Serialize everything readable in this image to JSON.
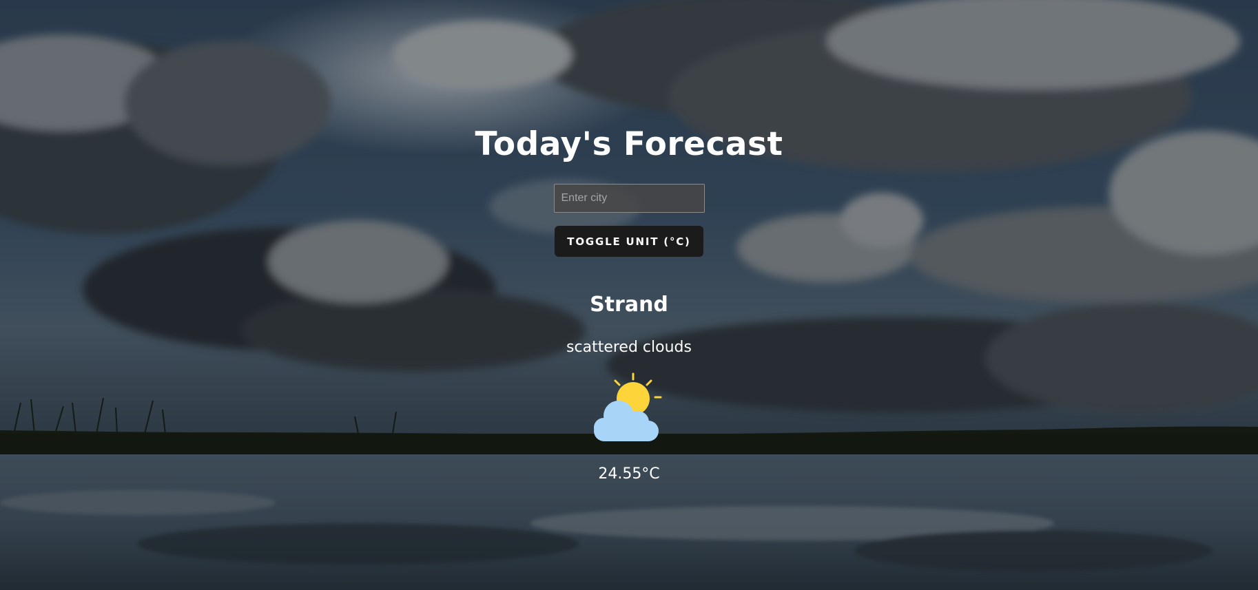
{
  "page": {
    "title": "Today's Forecast"
  },
  "search": {
    "placeholder": "Enter city",
    "value": ""
  },
  "toggle": {
    "label": "TOGGLE UNIT (°C)"
  },
  "weather": {
    "city": "Strand",
    "description": "scattered clouds",
    "icon": "partly-cloudy-icon",
    "temperature": "24.55°C"
  },
  "colors": {
    "button_bg": "#1b1b1b",
    "input_bg": "#464646",
    "text": "#ffffff",
    "sun": "#fdd43a",
    "cloud": "#a8d4f7"
  }
}
